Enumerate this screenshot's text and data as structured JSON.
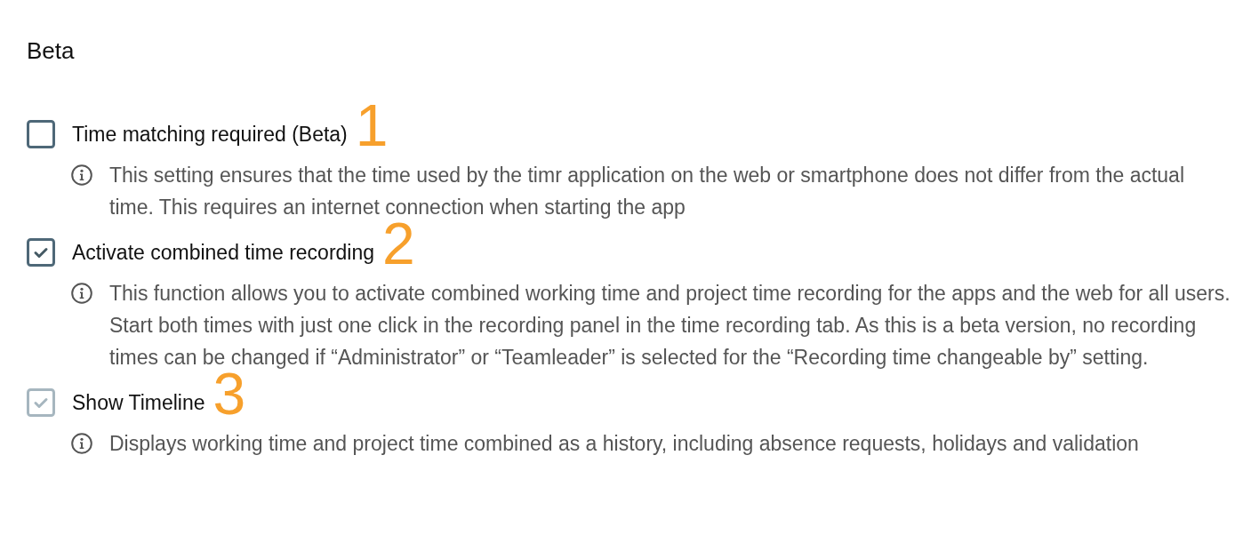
{
  "section": {
    "title": "Beta"
  },
  "settings": [
    {
      "label": "Time matching required (Beta)",
      "checked": false,
      "disabled": false,
      "annotation": "1",
      "description": "This setting ensures that the time used by the timr application on the web or smartphone does not differ from the actual time. This requires an internet connection when starting the app"
    },
    {
      "label": "Activate combined time recording",
      "checked": true,
      "disabled": false,
      "annotation": "2",
      "description": "This function allows you to activate combined working time and project time recording for the apps and the web for all users. Start both times with just one click in the recording panel in the time recording tab. As this is a beta version, no recording times can be changed if “Administrator” or “Teamleader” is selected for the “Recording time changeable by” setting."
    },
    {
      "label": "Show Timeline",
      "checked": true,
      "disabled": true,
      "annotation": "3",
      "description": "Displays working time and project time combined as a history, including absence requests, holidays and validation"
    }
  ]
}
